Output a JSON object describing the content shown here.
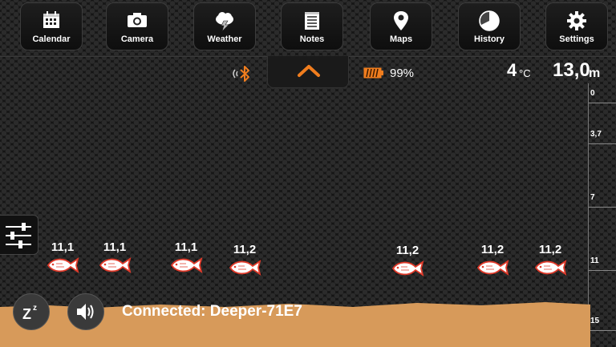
{
  "nav": {
    "calendar": "Calendar",
    "camera": "Camera",
    "weather": "Weather",
    "notes": "Notes",
    "maps": "Maps",
    "history": "History",
    "settings": "Settings"
  },
  "status": {
    "battery_percent": "99%",
    "temperature_value": "4",
    "temperature_unit": "°C",
    "depth_value": "13,0",
    "depth_unit": "m"
  },
  "depth_scale": [
    "0",
    "3,7",
    "7",
    "11",
    "15"
  ],
  "fish": [
    {
      "depth": "11,1"
    },
    {
      "depth": "11,1"
    },
    {
      "depth": "11,1"
    },
    {
      "depth": "11,2"
    },
    {
      "depth": "11,2"
    },
    {
      "depth": "11,2"
    },
    {
      "depth": "11,2"
    }
  ],
  "connection": "Connected: Deeper-71E7",
  "colors": {
    "accent": "#f07d1e",
    "sand": "#d79a5a",
    "fish_outline": "#e03a2a"
  },
  "icons": [
    "calendar-icon",
    "camera-icon",
    "weather-icon",
    "notes-icon",
    "maps-icon",
    "history-icon",
    "settings-icon",
    "bluetooth-icon",
    "battery-icon",
    "chevron-up-icon",
    "sleep-icon",
    "sound-icon",
    "filter-sliders-icon",
    "fish-icon"
  ]
}
